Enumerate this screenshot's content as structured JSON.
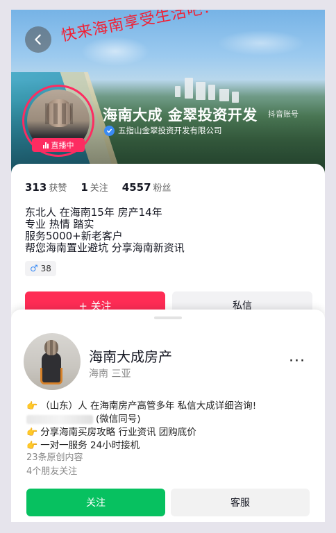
{
  "banner": {
    "handwriting_text": "快来海南享受生活吧！",
    "account_name": "海南大成 金翠投资开发",
    "account_tag": "抖音账号",
    "verified_org": "五指山金翠投资开发有限公司",
    "live_badge": "直播中"
  },
  "stats": {
    "likes_value": "313",
    "likes_label": "获赞",
    "following_value": "1",
    "following_label": "关注",
    "fans_value": "4557",
    "fans_label": "粉丝"
  },
  "bio_lines": [
    "东北人 在海南15年 房产14年",
    "专业 热情 踏实",
    "服务5000+新老客户",
    "帮您海南置业避坑 分享海南新资讯"
  ],
  "gender_age": "38",
  "actions_top": {
    "follow": "+ 关注",
    "message": "私信"
  },
  "sheet": {
    "name": "海南大成房产",
    "location": "海南 三亚",
    "more": "···",
    "desc": {
      "line1": "（山东）人  在海南房产高管多年 私信大成详细咨询!",
      "line2_suffix": "(微信同号)",
      "line3": "分享海南买房攻略 行业资讯  团购底价",
      "line4": "一对一服务  24小时接机"
    },
    "original_content": "23条原创内容",
    "friends_follow": "4个朋友关注",
    "follow_button": "关注",
    "service_button": "客服"
  },
  "colors": {
    "primary_red": "#fe2c55",
    "wechat_green": "#07c160",
    "verify_blue": "#3a8bf5"
  },
  "icons": [
    "back-arrow-icon",
    "verified-icon",
    "live-bars-icon",
    "male-icon",
    "pointing-hand-icon"
  ]
}
